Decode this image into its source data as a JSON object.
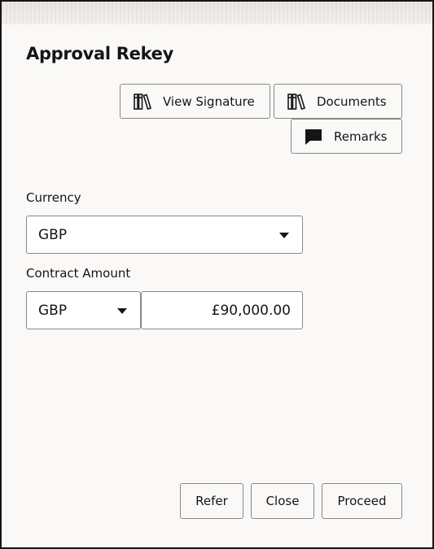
{
  "dialog": {
    "title": "Approval Rekey"
  },
  "toolbar": {
    "view_signature_label": "View Signature",
    "documents_label": "Documents",
    "remarks_label": "Remarks"
  },
  "form": {
    "currency": {
      "label": "Currency",
      "value": "GBP"
    },
    "contract_amount": {
      "label": "Contract Amount",
      "currency_value": "GBP",
      "amount_value": "£90,000.00"
    }
  },
  "footer": {
    "refer_label": "Refer",
    "close_label": "Close",
    "proceed_label": "Proceed"
  },
  "icons": {
    "view_signature": "library-books-icon",
    "documents": "library-books-icon",
    "remarks": "speech-bubble-icon"
  }
}
